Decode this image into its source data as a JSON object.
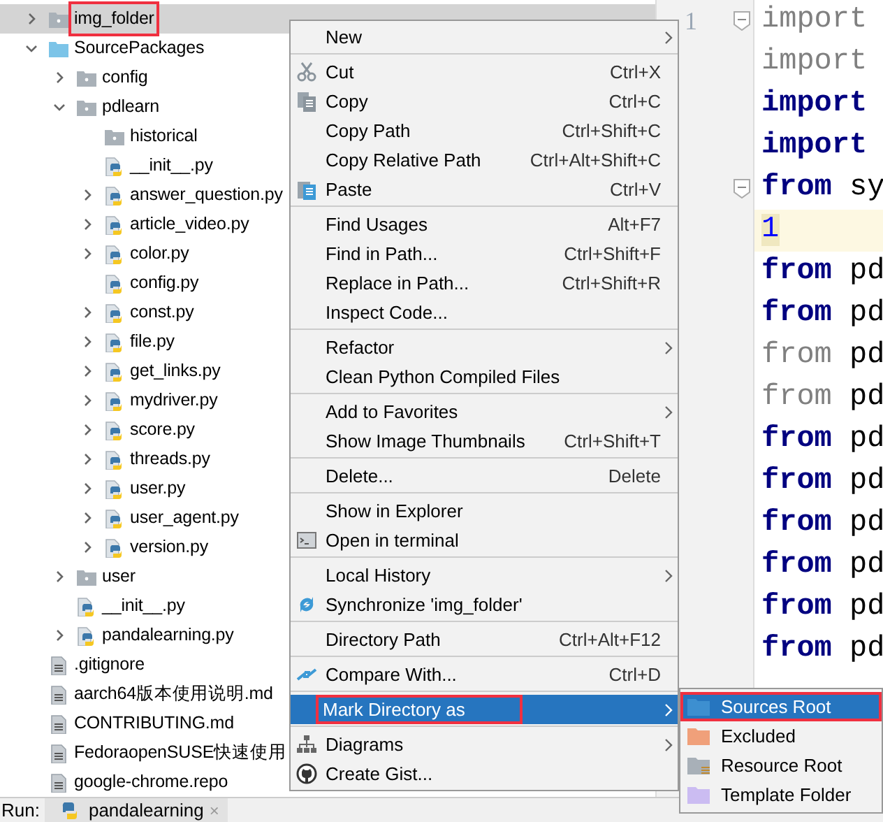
{
  "project_tree": [
    {
      "label": "img_folder",
      "kind": "folder",
      "expanded": false,
      "selected": true,
      "annotated": true
    },
    {
      "label": "SourcePackages",
      "kind": "source_folder",
      "expanded": true,
      "selected": false,
      "children": [
        {
          "label": "config",
          "kind": "folder",
          "expanded": false,
          "selected": false
        },
        {
          "label": "pdlearn",
          "kind": "folder",
          "expanded": true,
          "selected": false,
          "children": [
            {
              "label": "historical",
              "kind": "folder",
              "selected": false
            },
            {
              "label": "__init__.py",
              "kind": "python",
              "selected": false
            },
            {
              "label": "answer_question.py",
              "kind": "python",
              "expanded": false,
              "selected": false
            },
            {
              "label": "article_video.py",
              "kind": "python",
              "expanded": false,
              "selected": false
            },
            {
              "label": "color.py",
              "kind": "python",
              "expanded": false,
              "selected": false
            },
            {
              "label": "config.py",
              "kind": "python",
              "selected": false
            },
            {
              "label": "const.py",
              "kind": "python",
              "expanded": false,
              "selected": false
            },
            {
              "label": "file.py",
              "kind": "python",
              "expanded": false,
              "selected": false
            },
            {
              "label": "get_links.py",
              "kind": "python",
              "expanded": false,
              "selected": false
            },
            {
              "label": "mydriver.py",
              "kind": "python",
              "expanded": false,
              "selected": false
            },
            {
              "label": "score.py",
              "kind": "python",
              "expanded": false,
              "selected": false
            },
            {
              "label": "threads.py",
              "kind": "python",
              "expanded": false,
              "selected": false
            },
            {
              "label": "user.py",
              "kind": "python",
              "expanded": false,
              "selected": false
            },
            {
              "label": "user_agent.py",
              "kind": "python",
              "expanded": false,
              "selected": false
            },
            {
              "label": "version.py",
              "kind": "python",
              "expanded": false,
              "selected": false
            }
          ]
        },
        {
          "label": "user",
          "kind": "folder",
          "expanded": false,
          "selected": false
        },
        {
          "label": "__init__.py",
          "kind": "python",
          "selected": false
        },
        {
          "label": "pandalearning.py",
          "kind": "python",
          "expanded": false,
          "selected": false
        }
      ]
    },
    {
      "label": ".gitignore",
      "kind": "text",
      "selected": false
    },
    {
      "label": "aarch64版本使用说明.md",
      "kind": "text",
      "selected": false
    },
    {
      "label": "CONTRIBUTING.md",
      "kind": "text",
      "selected": false
    },
    {
      "label": "FedoraopenSUSE快速使用",
      "kind": "text",
      "selected": false
    },
    {
      "label": "google-chrome.repo",
      "kind": "text",
      "selected": false
    }
  ],
  "editor": {
    "line_numbers": [
      "1"
    ],
    "lines": [
      {
        "keyword": "import",
        "kind": "unused",
        "fold_marker": true,
        "current": false
      },
      {
        "keyword": "import",
        "kind": "unused",
        "current": false
      },
      {
        "keyword": "import",
        "kind": "normal",
        "current": false
      },
      {
        "keyword": "import",
        "kind": "normal",
        "current": false
      },
      {
        "keyword": "from",
        "rest": "sy",
        "kind": "normal",
        "fold_marker": true,
        "current": false
      },
      {
        "rest": "1",
        "kind": "number",
        "current": true
      },
      {
        "keyword": "from",
        "rest": "pd",
        "kind": "normal",
        "current": false
      },
      {
        "keyword": "from",
        "rest": "pd",
        "kind": "normal",
        "current": false
      },
      {
        "keyword": "from",
        "rest": "pd",
        "kind": "unused",
        "current": false
      },
      {
        "keyword": "from",
        "rest": "pd",
        "kind": "unused",
        "current": false
      },
      {
        "keyword": "from",
        "rest": "pd",
        "kind": "normal",
        "current": false
      },
      {
        "keyword": "from",
        "rest": "pd",
        "kind": "normal",
        "current": false
      },
      {
        "keyword": "from",
        "rest": "pd",
        "kind": "normal",
        "current": false
      },
      {
        "keyword": "from",
        "rest": "pd",
        "kind": "normal",
        "current": false
      },
      {
        "keyword": "from",
        "rest": "pd",
        "kind": "normal",
        "current": false
      },
      {
        "keyword": "from",
        "rest": "pd",
        "kind": "normal",
        "current": false
      }
    ]
  },
  "context_menu": {
    "groups": [
      [
        {
          "label": "New",
          "submenu": true,
          "selected": false
        }
      ],
      [
        {
          "label": "Cut",
          "shortcut": "Ctrl+X",
          "kind": "scissors",
          "selected": false
        },
        {
          "label": "Copy",
          "shortcut": "Ctrl+C",
          "kind": "copy",
          "selected": false
        },
        {
          "label": "Copy Path",
          "shortcut": "Ctrl+Shift+C",
          "selected": false
        },
        {
          "label": "Copy Relative Path",
          "shortcut": "Ctrl+Alt+Shift+C",
          "selected": false
        },
        {
          "label": "Paste",
          "shortcut": "Ctrl+V",
          "kind": "paste",
          "selected": false
        }
      ],
      [
        {
          "label": "Find Usages",
          "shortcut": "Alt+F7",
          "selected": false
        },
        {
          "label": "Find in Path...",
          "shortcut": "Ctrl+Shift+F",
          "selected": false
        },
        {
          "label": "Replace in Path...",
          "shortcut": "Ctrl+Shift+R",
          "selected": false
        },
        {
          "label": "Inspect Code...",
          "selected": false
        }
      ],
      [
        {
          "label": "Refactor",
          "submenu": true,
          "selected": false
        },
        {
          "label": "Clean Python Compiled Files",
          "selected": false
        }
      ],
      [
        {
          "label": "Add to Favorites",
          "submenu": true,
          "selected": false
        },
        {
          "label": "Show Image Thumbnails",
          "shortcut": "Ctrl+Shift+T",
          "selected": false
        }
      ],
      [
        {
          "label": "Delete...",
          "shortcut": "Delete",
          "selected": false
        }
      ],
      [
        {
          "label": "Show in Explorer",
          "selected": false
        },
        {
          "label": "Open in terminal",
          "kind": "terminal",
          "selected": false
        }
      ],
      [
        {
          "label": "Local History",
          "submenu": true,
          "selected": false
        },
        {
          "label": "Synchronize 'img_folder'",
          "kind": "sync",
          "selected": false
        }
      ],
      [
        {
          "label": "Directory Path",
          "shortcut": "Ctrl+Alt+F12",
          "selected": false
        }
      ],
      [
        {
          "label": "Compare With...",
          "shortcut": "Ctrl+D",
          "kind": "compare",
          "selected": false
        }
      ],
      [
        {
          "label": "Mark Directory as",
          "submenu": true,
          "selected": true,
          "annotated": true
        }
      ],
      [
        {
          "label": "Diagrams",
          "submenu": true,
          "kind": "diagram",
          "selected": false
        },
        {
          "label": "Create Gist...",
          "kind": "github",
          "selected": false
        }
      ]
    ]
  },
  "submenu": [
    {
      "label": "Sources Root",
      "color": "#3d8fd0",
      "kind": "folder",
      "selected": true,
      "annotated": true
    },
    {
      "label": "Excluded",
      "color": "#f0a07a",
      "kind": "folder",
      "selected": false
    },
    {
      "label": "Resource Root",
      "color": "#a8b0b8",
      "kind": "resource",
      "selected": false
    },
    {
      "label": "Template Folder",
      "color": "#cbbcf2",
      "kind": "folder",
      "selected": false
    }
  ],
  "run_bar": {
    "label": "Run:",
    "tab": "pandalearning",
    "close": "×"
  }
}
